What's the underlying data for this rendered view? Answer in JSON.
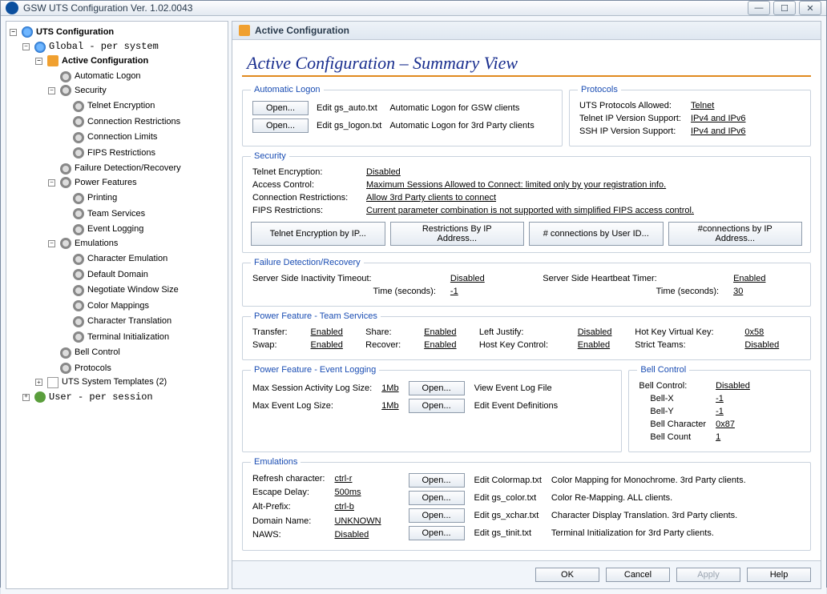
{
  "window": {
    "title": "GSW UTS Configuration      Ver. 1.02.0043"
  },
  "tree": {
    "root": "UTS Configuration",
    "global": "Global  - per system",
    "active_cfg": "Active Configuration",
    "auto_logon": "Automatic Logon",
    "security": "Security",
    "sec_telnet": "Telnet Encryption",
    "sec_connrest": "Connection Restrictions",
    "sec_connlim": "Connection Limits",
    "sec_fips": "FIPS Restrictions",
    "fdr": "Failure Detection/Recovery",
    "power": "Power Features",
    "pf_print": "Printing",
    "pf_team": "Team Services",
    "pf_event": "Event Logging",
    "emul": "Emulations",
    "em_char": "Character Emulation",
    "em_dom": "Default Domain",
    "em_naw": "Negotiate Window Size",
    "em_colmap": "Color Mappings",
    "em_chartr": "Character Translation",
    "em_tinit": "Terminal Initialization",
    "bell": "Bell Control",
    "protocols": "Protocols",
    "templates": "UTS System Templates (2)",
    "user": "User   - per session"
  },
  "header": {
    "title": "Active Configuration"
  },
  "page_title": "Active Configuration – Summary View",
  "auto_logon": {
    "legend": "Automatic Logon",
    "open": "Open...",
    "edit1": "Edit gs_auto.txt",
    "desc1": "Automatic Logon for GSW clients",
    "edit2": "Edit gs_logon.txt",
    "desc2": "Automatic Logon for 3rd Party clients"
  },
  "protocols": {
    "legend": "Protocols",
    "l1": "UTS Protocols Allowed:",
    "v1": "Telnet",
    "l2": "Telnet IP Version Support:",
    "v2": "IPv4 and IPv6",
    "l3": "SSH IP Version Support:",
    "v3": "IPv4 and IPv6"
  },
  "security": {
    "legend": "Security",
    "l1": "Telnet Encryption:",
    "v1": "Disabled",
    "l2": "Access Control:",
    "v2": "Maximum Sessions Allowed to Connect: limited only by your registration info.",
    "l3": "Connection Restrictions:",
    "v3": "Allow 3rd Party clients to connect",
    "l4": "FIPS Restrictions:",
    "v4": "Current parameter combination is not supported with simplified FIPS access control.",
    "b1": "Telnet Encryption by IP...",
    "b2": "Restrictions By IP Address...",
    "b3": "# connections by User ID...",
    "b4": "#connections by IP Address..."
  },
  "fdr": {
    "legend": "Failure Detection/Recovery",
    "l1": "Server Side Inactivity Timeout:",
    "v1": "Disabled",
    "l2": "Time (seconds):",
    "v2": "-1",
    "l3": "Server Side Heartbeat Timer:",
    "v3": "Enabled",
    "l4": "Time (seconds):",
    "v4": "30"
  },
  "pf_team": {
    "legend": "Power Feature - Team Services",
    "transfer_l": "Transfer:",
    "transfer_v": "Enabled",
    "share_l": "Share:",
    "share_v": "Enabled",
    "lj_l": "Left Justify:",
    "lj_v": "Disabled",
    "hk_l": "Hot Key Virtual Key:",
    "hk_v": "0x58",
    "swap_l": "Swap:",
    "swap_v": "Enabled",
    "rec_l": "Recover:",
    "rec_v": "Enabled",
    "hkc_l": "Host Key Control:",
    "hkc_v": "Enabled",
    "st_l": "Strict Teams:",
    "st_v": "Disabled"
  },
  "pf_event": {
    "legend": "Power Feature - Event Logging",
    "l1": "Max Session Activity Log Size:",
    "v1": "1Mb",
    "l2": "Max Event Log Size:",
    "v2": "1Mb",
    "open": "Open...",
    "d1": "View Event Log File",
    "d2": "Edit Event Definitions"
  },
  "bell": {
    "legend": "Bell Control",
    "l1": "Bell Control:",
    "v1": "Disabled",
    "l2": "Bell-X",
    "v2": "-1",
    "l3": "Bell-Y",
    "v3": "-1",
    "l4": "Bell Character",
    "v4": "0x87",
    "l5": "Bell Count",
    "v5": "1"
  },
  "emul": {
    "legend": "Emulations",
    "l1": "Refresh character:",
    "v1": "ctrl-r",
    "l2": "Escape Delay:",
    "v2": "500ms",
    "l3": "Alt-Prefix:",
    "v3": "ctrl-b",
    "l4": "Domain Name:",
    "v4": "UNKNOWN",
    "l5": "NAWS:",
    "v5": "Disabled",
    "open": "Open...",
    "e1": "Edit Colormap.txt",
    "d1": "Color Mapping for Monochrome. 3rd Party clients.",
    "e2": "Edit gs_color.txt",
    "d2": "Color Re-Mapping. ALL clients.",
    "e3": "Edit gs_xchar.txt",
    "d3": "Character Display Translation. 3rd Party clients.",
    "e4": "Edit gs_tinit.txt",
    "d4": "Terminal Initialization for 3rd Party clients."
  },
  "footer": {
    "ok": "OK",
    "cancel": "Cancel",
    "apply": "Apply",
    "help": "Help"
  }
}
